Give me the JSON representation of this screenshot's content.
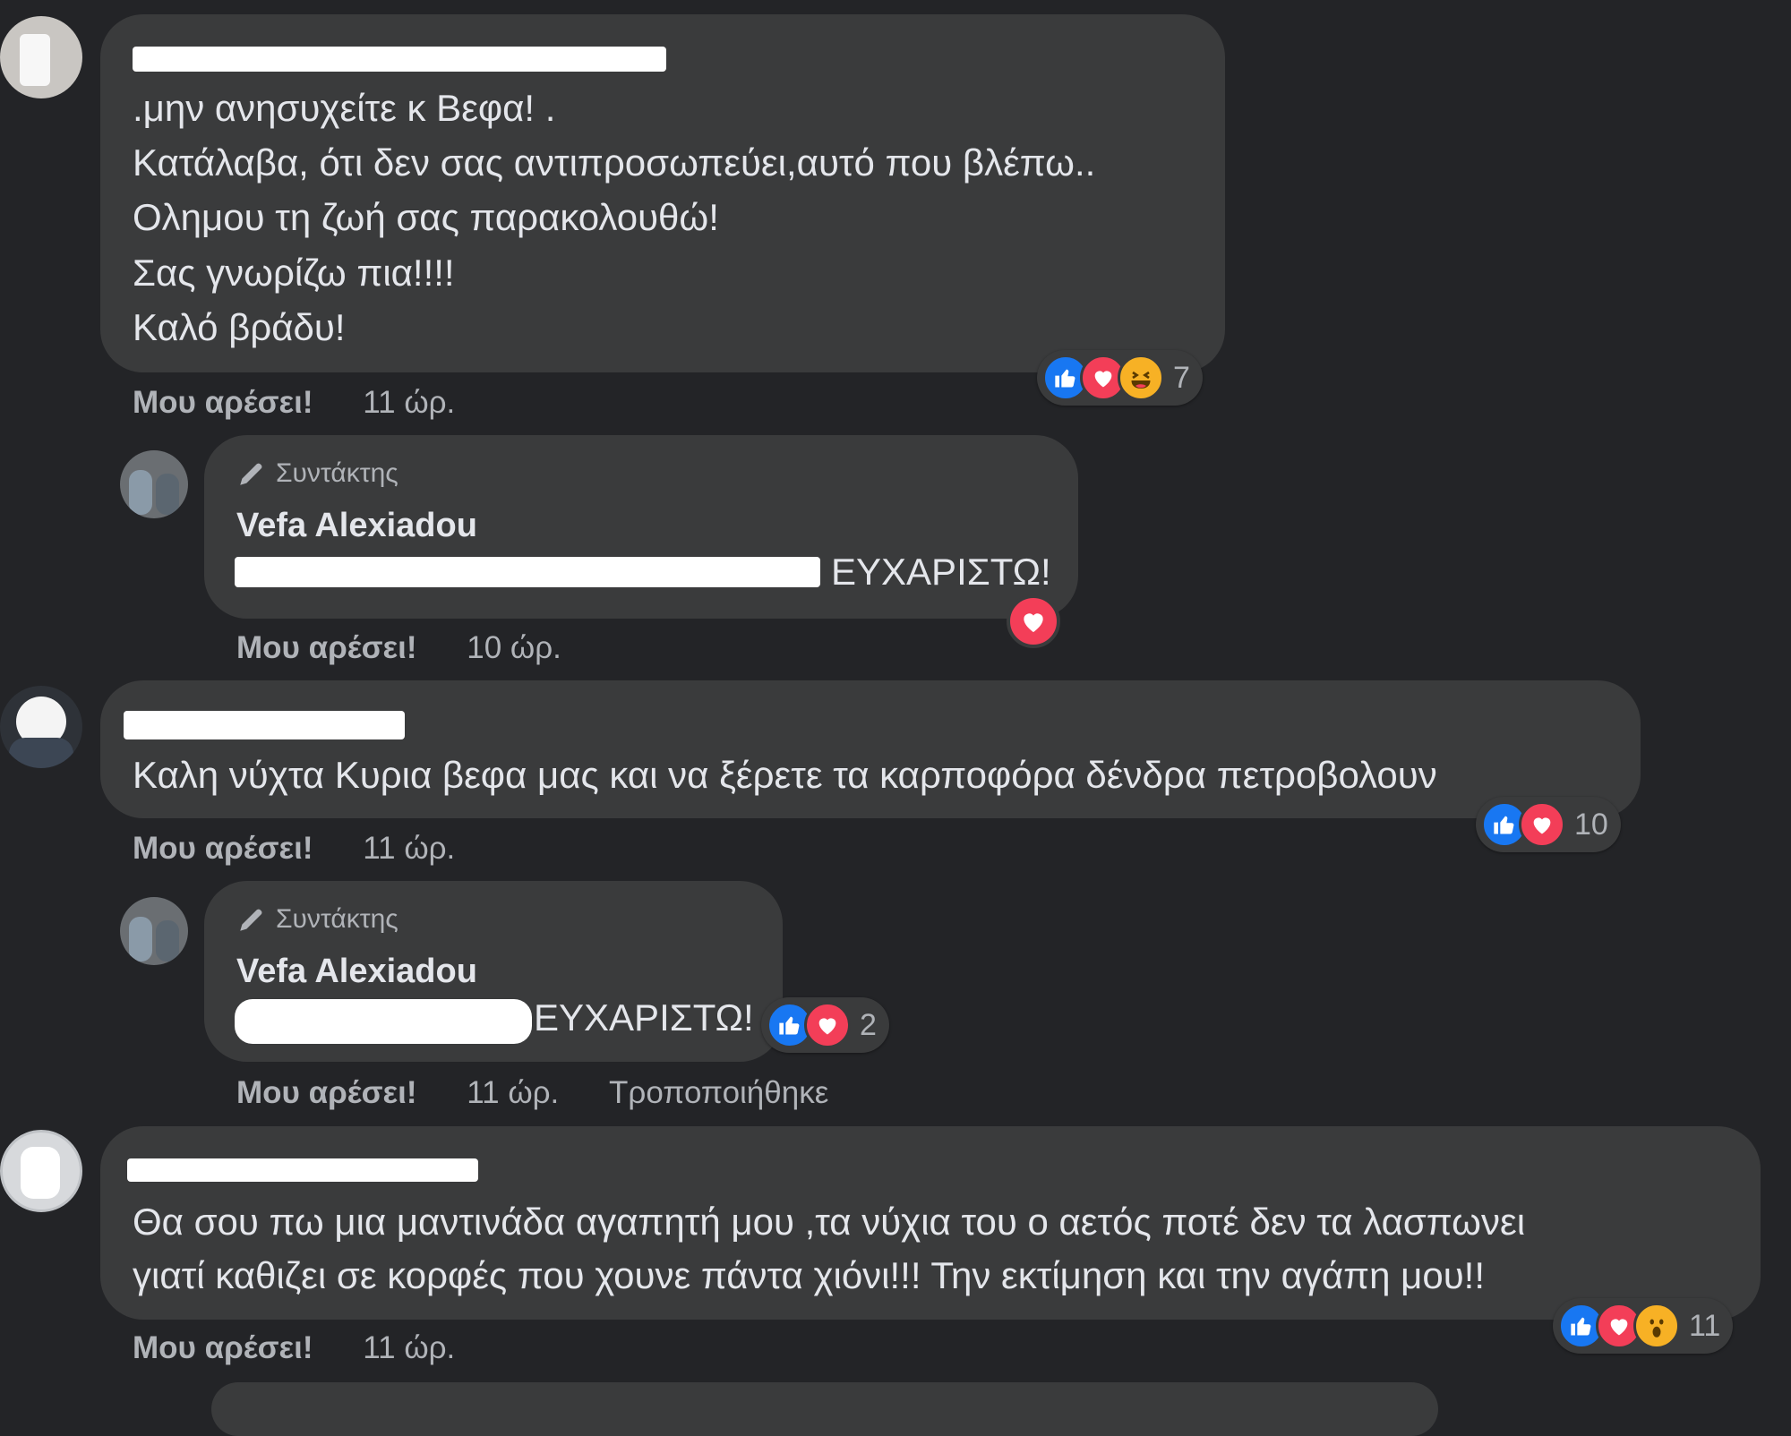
{
  "comments": [
    {
      "lines": [
        ".μην ανησυχείτε κ Βεφα! .",
        "Κατάλαβα, ότι δεν σας αντιπροσωπεύει,αυτό που βλέπω..",
        "Ολημου τη ζωή σας παρακολουθώ!",
        "Σας γνωρίζω πια!!!!",
        "Καλό βράδυ!"
      ],
      "like_label": "Μου αρέσει!",
      "time": "11 ώρ.",
      "reactions": [
        "like",
        "love",
        "haha"
      ],
      "reaction_count": "7"
    },
    {
      "lines": [
        "Καλη νύχτα Κυρια βεφα μας και να ξέρετε τα καρποφόρα δένδρα πετροβολουν"
      ],
      "like_label": "Μου αρέσει!",
      "time": "11 ώρ.",
      "reactions": [
        "like",
        "love"
      ],
      "reaction_count": "10"
    },
    {
      "lines": [
        "Θα σου πω μια μαντινάδα αγαπητή μου ,τα νύχια του ο αετός ποτέ δεν τα λασπωνει",
        "γιατί καθιζει σε κορφές που χουνε πάντα χιόνι!!! Την εκτίμηση και την αγάπη μου!!"
      ],
      "like_label": "Μου αρέσει!",
      "time": "11 ώρ.",
      "reactions": [
        "like",
        "love",
        "wow"
      ],
      "reaction_count": "11"
    }
  ],
  "replies": [
    {
      "badge": "Συντάκτης",
      "author": "Vefa Alexiadou",
      "text": "ΕΥΧΑΡΙΣΤΩ!",
      "like_label": "Μου αρέσει!",
      "time": "10 ώρ.",
      "reactions": [
        "love"
      ]
    },
    {
      "badge": "Συντάκτης",
      "author": "Vefa Alexiadou",
      "text": "ΕΥΧΑΡΙΣΤΩ!",
      "like_label": "Μου αρέσει!",
      "time": "11 ώρ.",
      "edited": "Τροποποιήθηκε",
      "reactions": [
        "like",
        "love"
      ],
      "reaction_count": "2"
    }
  ],
  "colors": {
    "background": "#232427",
    "bubble": "#3a3b3c",
    "like": "#1877f2",
    "love": "#f33e58",
    "haha": "#f7b125"
  }
}
